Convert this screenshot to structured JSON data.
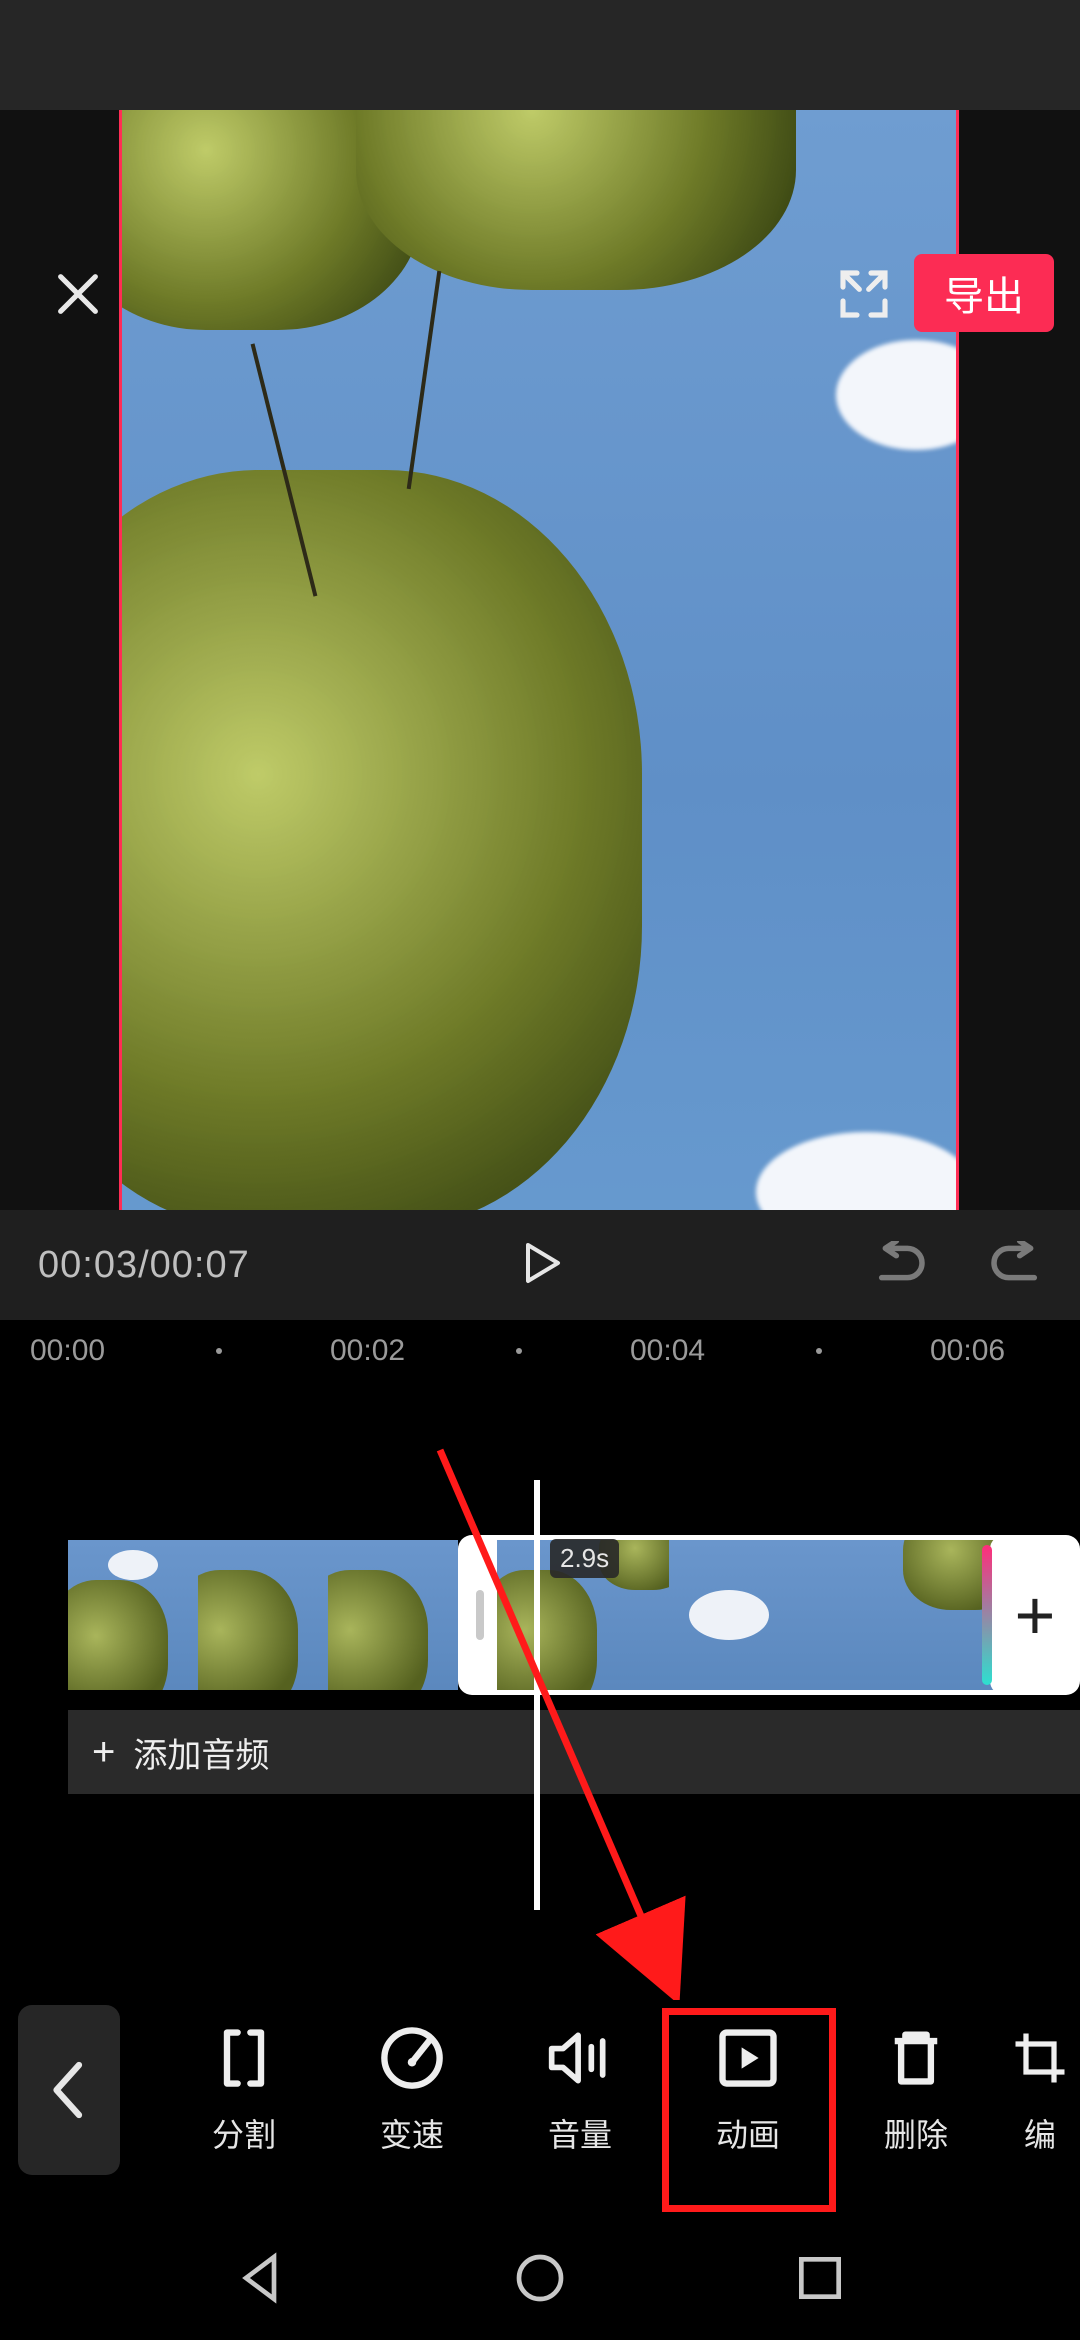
{
  "header": {
    "export_label": "导出"
  },
  "transport": {
    "current_time": "00:03",
    "total_time": "00:07"
  },
  "ruler": {
    "marks": [
      "00:00",
      "00:02",
      "00:04",
      "00:06"
    ]
  },
  "timeline": {
    "selected_clip_duration": "2.9s",
    "add_audio_label": "添加音频"
  },
  "tools": {
    "back": "返回",
    "items": [
      {
        "id": "split",
        "label": "分割"
      },
      {
        "id": "speed",
        "label": "变速"
      },
      {
        "id": "volume",
        "label": "音量"
      },
      {
        "id": "animation",
        "label": "动画"
      },
      {
        "id": "delete",
        "label": "删除"
      },
      {
        "id": "edit",
        "label": "编"
      }
    ]
  },
  "annotation": {
    "highlighted_tool": "animation"
  }
}
